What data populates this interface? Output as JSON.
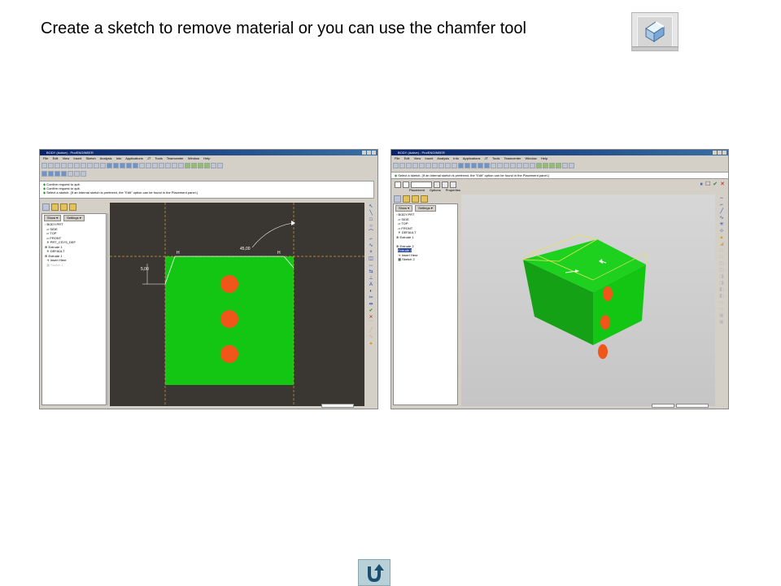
{
  "caption": "Create a sketch to remove material or you can use the chamfer tool",
  "left_window": {
    "title": "BODY (Active) - Pro/ENGINEER",
    "menu": [
      "File",
      "Edit",
      "View",
      "Insert",
      "Sketch",
      "Analysis",
      "Info",
      "Applications",
      "JT",
      "Tools",
      "Teamcenter",
      "Window",
      "Help"
    ],
    "messages": [
      "Confirm request to quit.",
      "Confirm request to quit.",
      "Select a sketch. (If an internal sketch is preferred, the \"Edit\" option can be found in the Placement panel.)"
    ],
    "tree_tabs": [
      "Show ▾",
      "Settings ▾"
    ],
    "tree_items": [
      "BODY.PRT",
      "SIDE",
      "TOP",
      "FRONT",
      "PRT_CSYS_DEF",
      "Extrude 1",
      "DEFAULT",
      "Extrude 1",
      "Insert Here",
      "Sketch 1"
    ],
    "dimensions": {
      "angle": "45,00",
      "vertical": "5,00",
      "h_left": "H",
      "h_right": "H"
    }
  },
  "right_window": {
    "title": "BODY (Active) - Pro/ENGINEER",
    "menu": [
      "File",
      "Edit",
      "View",
      "Insert",
      "Analysis",
      "Info",
      "Applications",
      "JT",
      "Tools",
      "Teamcenter",
      "Window",
      "Help"
    ],
    "messages": [
      "Select a sketch. (If an internal sketch is preferred, the \"Edit\" option can be found in the Placement panel.)"
    ],
    "dashboard_tabs": [
      "Placement",
      "Options",
      "Properties"
    ],
    "tree_tabs": [
      "Show ▾",
      "Settings ▾"
    ],
    "tree_items": [
      "BODY.PRT",
      "SIDE",
      "TOP",
      "FRONT",
      "DEFAULT",
      "Extrude 1",
      "Extrude 2",
      "Extrude 2",
      "Insert Here",
      "Sketch 2"
    ],
    "highlighted_item": "Extrude 2"
  },
  "colors": {
    "part_green": "#13c613",
    "hole_orange": "#f0561a",
    "sketch_bg": "#3a3733"
  }
}
